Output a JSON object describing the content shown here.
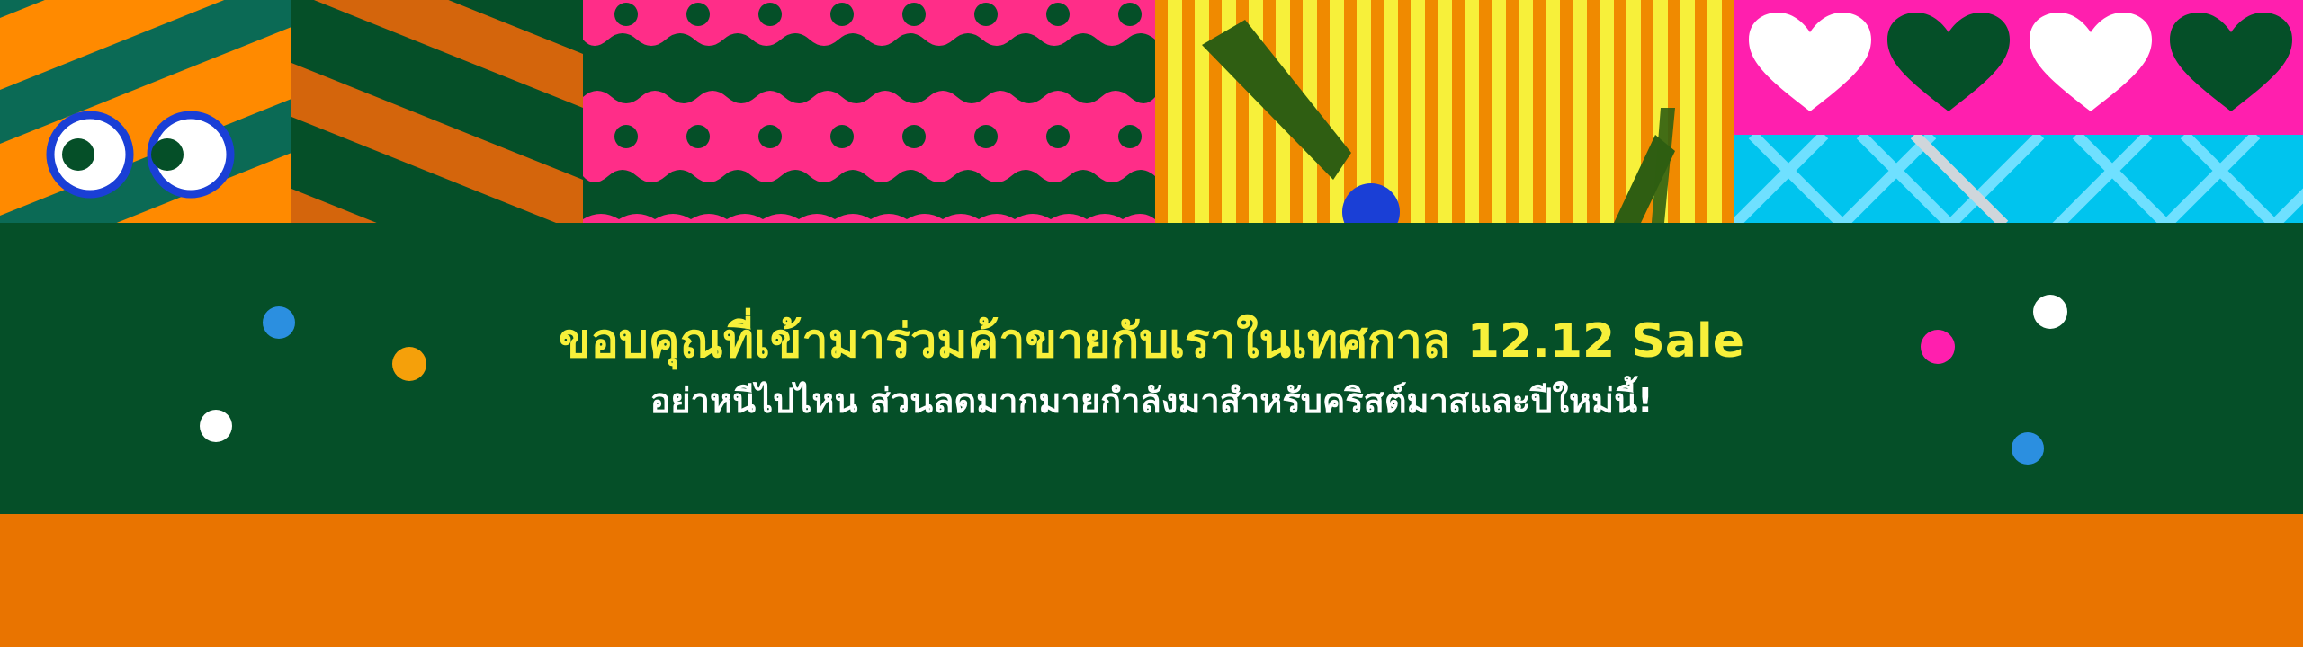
{
  "banner": {
    "headline": "ขอบคุณที่เข้ามาร่วมค้าขายกับเราในเทศกาล 12.12 Sale",
    "subline": "อย่าหนีไปไหน ส่วนลดมากมายกำลังมาสำหรับคริสต์มาสและปีใหม่นี้!"
  },
  "colors": {
    "dark_green": "#054f28",
    "orange": "#e97400",
    "yellow_text": "#f7f03a",
    "magenta": "#ff2d88",
    "cyan": "#00c4ee",
    "blue": "#1a3fd6"
  },
  "decor": {
    "eyes": "googly-eyes",
    "patterns": [
      "diagonal-stripes",
      "wavy-dots",
      "vertical-stripes",
      "hearts-and-lattice"
    ]
  }
}
